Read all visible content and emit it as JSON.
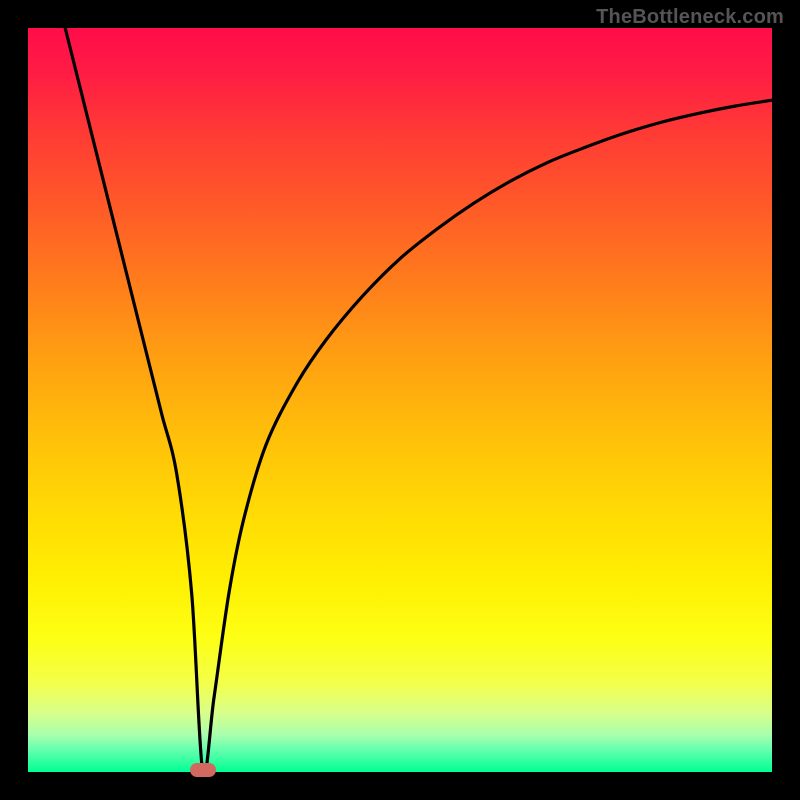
{
  "watermark": "TheBottleneck.com",
  "chart_data": {
    "type": "line",
    "title": "",
    "xlabel": "",
    "ylabel": "",
    "xlim": [
      0,
      100
    ],
    "ylim": [
      0,
      100
    ],
    "grid": false,
    "series": [
      {
        "name": "bottleneck-curve",
        "x": [
          5,
          8,
          10,
          12,
          14,
          16,
          18,
          20,
          22,
          23.5,
          25,
          27,
          29,
          32,
          36,
          40,
          45,
          50,
          55,
          60,
          65,
          70,
          75,
          80,
          85,
          90,
          95,
          100
        ],
        "y": [
          100,
          88,
          80,
          72,
          64,
          56,
          48,
          40,
          24,
          0,
          10,
          24,
          34,
          44,
          52,
          58,
          64,
          69,
          73,
          76.5,
          79.5,
          82,
          84,
          85.8,
          87.3,
          88.5,
          89.5,
          90.3
        ]
      }
    ],
    "annotations": [
      {
        "name": "optimal-marker",
        "x": 23.5,
        "y": 0,
        "color": "#d26960"
      }
    ]
  },
  "colors": {
    "background": "#000000",
    "curve": "#000000",
    "marker": "#d26960"
  }
}
